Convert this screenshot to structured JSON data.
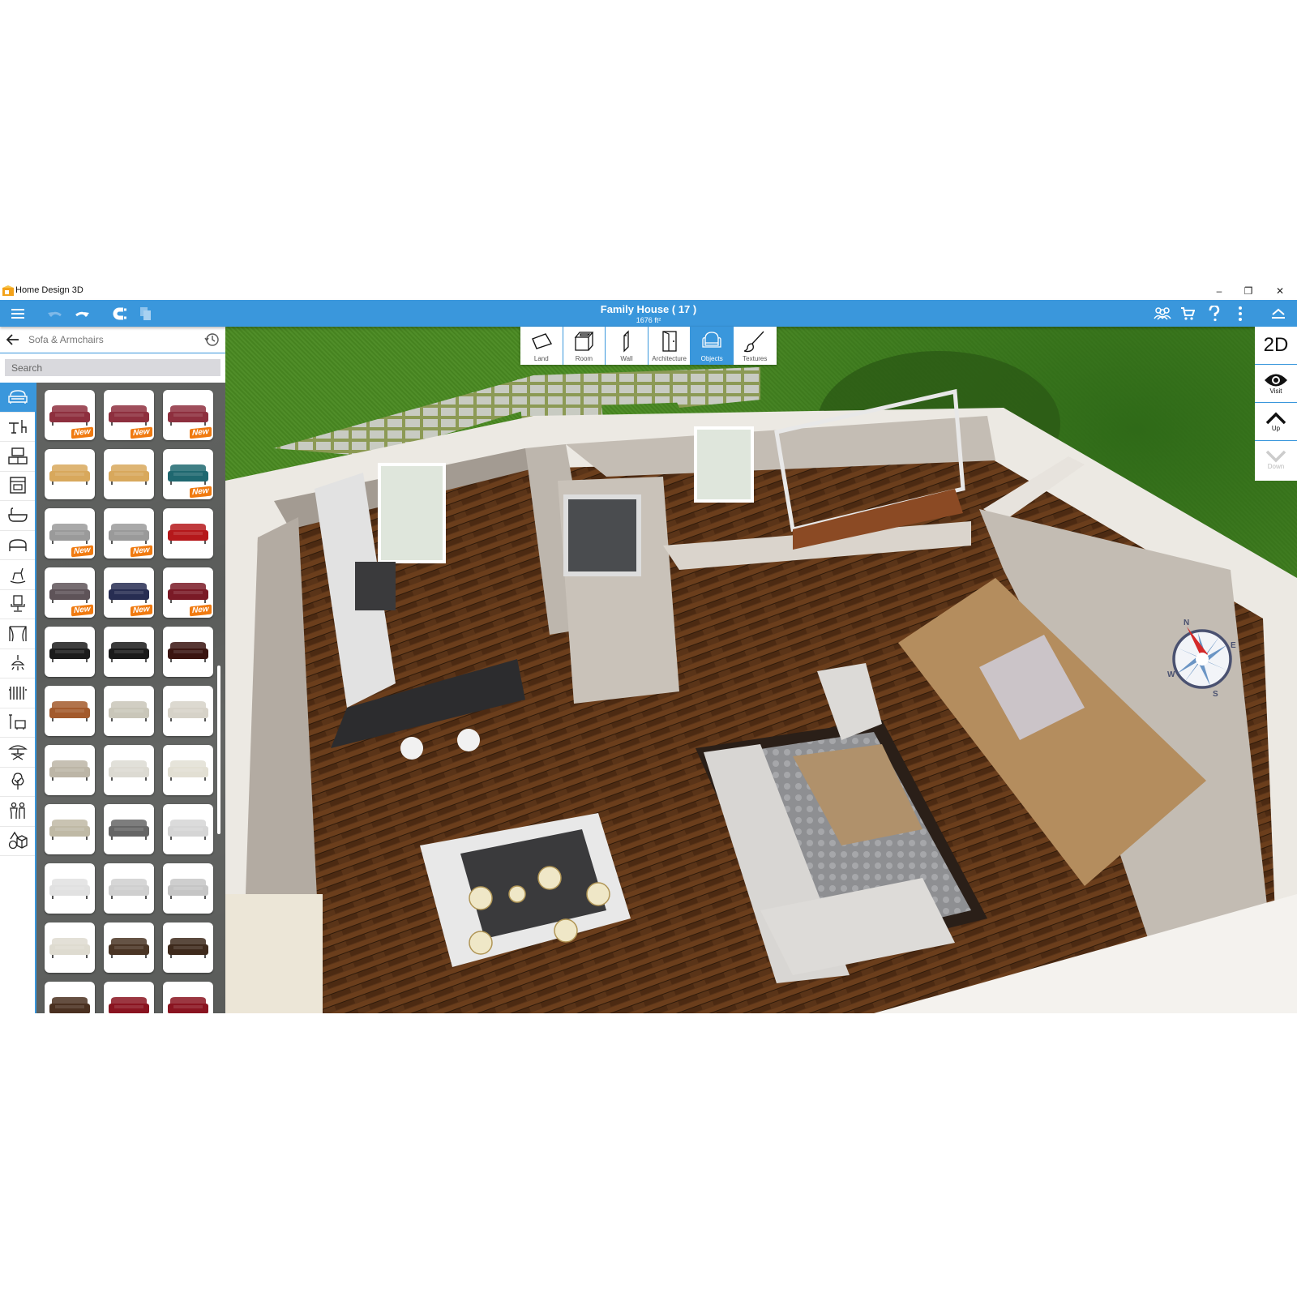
{
  "window": {
    "app_title": "Home Design 3D",
    "controls": {
      "minimize": "–",
      "restore": "❐",
      "close": "✕"
    }
  },
  "toolbar": {
    "menu_icon": "hamburger-icon",
    "undo_icon": "undo-icon",
    "redo_icon": "redo-icon",
    "magnet_icon": "magnet-icon",
    "duplicate_icon": "duplicate-icon",
    "document_title": "Family House ( 17 )",
    "document_area": "1676 ft²",
    "right_icons": [
      "community-icon",
      "cart-icon",
      "help-icon",
      "more-icon",
      "collapse-icon"
    ],
    "accent_color": "#3a97dc"
  },
  "panel": {
    "category_title": "Sofa & Armchairs",
    "search_placeholder": "Search",
    "categories": [
      {
        "name": "sofa",
        "active": true
      },
      {
        "name": "dining",
        "active": false
      },
      {
        "name": "tv-furniture",
        "active": false
      },
      {
        "name": "kitchen-appliance",
        "active": false
      },
      {
        "name": "bathroom",
        "active": false
      },
      {
        "name": "bed",
        "active": false
      },
      {
        "name": "kids",
        "active": false
      },
      {
        "name": "office-chair",
        "active": false
      },
      {
        "name": "curtains",
        "active": false
      },
      {
        "name": "lighting",
        "active": false
      },
      {
        "name": "radiator",
        "active": false
      },
      {
        "name": "garage",
        "active": false
      },
      {
        "name": "outdoor",
        "active": false
      },
      {
        "name": "plants",
        "active": false
      },
      {
        "name": "people",
        "active": false
      },
      {
        "name": "misc-shapes",
        "active": false
      }
    ],
    "new_badge": "New",
    "items": [
      {
        "color": "#8e2f3e",
        "new": true
      },
      {
        "color": "#8e2f3e",
        "new": true
      },
      {
        "color": "#8e2f3e",
        "new": true
      },
      {
        "color": "#d8a85c",
        "new": false
      },
      {
        "color": "#d8a85c",
        "new": false
      },
      {
        "color": "#1f6870",
        "new": true
      },
      {
        "color": "#9a9a9a",
        "new": true
      },
      {
        "color": "#9a9a9a",
        "new": true
      },
      {
        "color": "#b5181b",
        "new": false
      },
      {
        "color": "#5e5358",
        "new": true
      },
      {
        "color": "#272d52",
        "new": true
      },
      {
        "color": "#7a1a26",
        "new": true
      },
      {
        "color": "#1c1c1c",
        "new": false
      },
      {
        "color": "#1a1a1a",
        "new": false
      },
      {
        "color": "#3a1410",
        "new": false
      },
      {
        "color": "#a35a2c",
        "new": false
      },
      {
        "color": "#c9c6b9",
        "new": false
      },
      {
        "color": "#d6d2c8",
        "new": false
      },
      {
        "color": "#bcb5a6",
        "new": false
      },
      {
        "color": "#dcdad2",
        "new": false
      },
      {
        "color": "#e2dfd3",
        "new": false
      },
      {
        "color": "#bfb9a5",
        "new": false
      },
      {
        "color": "#666666",
        "new": false
      },
      {
        "color": "#d5d5d5",
        "new": false
      },
      {
        "color": "#e1e1e1",
        "new": false
      },
      {
        "color": "#cfcfcf",
        "new": false
      },
      {
        "color": "#c5c5c5",
        "new": false
      },
      {
        "color": "#dedbd0",
        "new": false
      },
      {
        "color": "#4a3525",
        "new": false
      },
      {
        "color": "#3e2a1c",
        "new": false
      },
      {
        "color": "#4a3020",
        "new": false
      },
      {
        "color": "#8a1420",
        "new": false
      },
      {
        "color": "#8a1420",
        "new": false
      }
    ]
  },
  "modes": [
    {
      "label": "Land",
      "icon": "land-icon",
      "active": false
    },
    {
      "label": "Room",
      "icon": "room-icon",
      "active": false
    },
    {
      "label": "Wall",
      "icon": "wall-icon",
      "active": false
    },
    {
      "label": "Architecture",
      "icon": "door-icon",
      "active": false
    },
    {
      "label": "Objects",
      "icon": "armchair-icon",
      "active": true
    },
    {
      "label": "Textures",
      "icon": "brush-icon",
      "active": false
    }
  ],
  "right_rail": {
    "view_2d": "2D",
    "visit": "Visit",
    "up": "Up",
    "down": "Down"
  },
  "compass": {
    "n": "N",
    "e": "E",
    "s": "S",
    "w": "W"
  }
}
